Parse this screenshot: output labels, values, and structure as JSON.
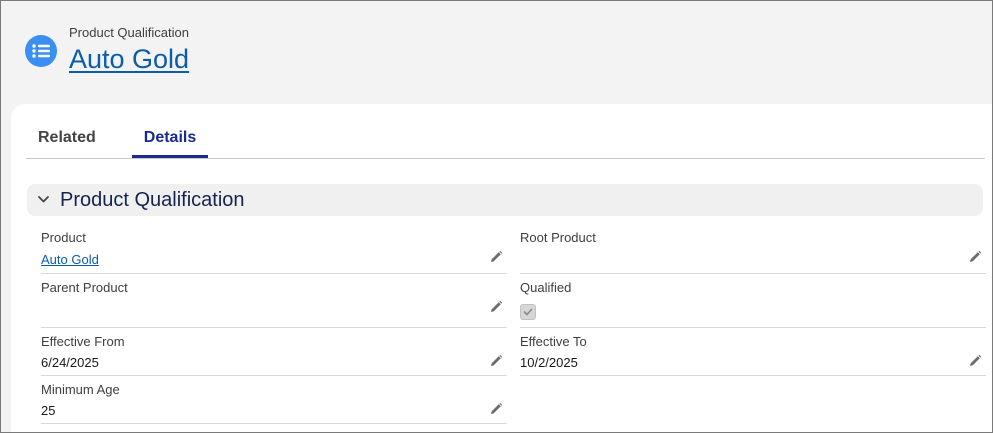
{
  "header": {
    "object_type": "Product Qualification",
    "record_title": "Auto Gold",
    "icon": "list-icon"
  },
  "tabs": [
    {
      "label": "Related",
      "active": false
    },
    {
      "label": "Details",
      "active": true
    }
  ],
  "section": {
    "title": "Product Qualification",
    "expanded": true
  },
  "fields": {
    "product": {
      "label": "Product",
      "value": "Auto Gold",
      "is_link": true
    },
    "root_product": {
      "label": "Root Product",
      "value": ""
    },
    "parent_product": {
      "label": "Parent Product",
      "value": ""
    },
    "qualified": {
      "label": "Qualified",
      "checked": true,
      "disabled": true
    },
    "effective_from": {
      "label": "Effective From",
      "value": "6/24/2025"
    },
    "effective_to": {
      "label": "Effective To",
      "value": "10/2/2025"
    },
    "minimum_age": {
      "label": "Minimum Age",
      "value": "25"
    }
  },
  "colors": {
    "brand_icon": "#3b8ff3",
    "link": "#0b5cab",
    "active_tab": "#1a2b8f"
  }
}
